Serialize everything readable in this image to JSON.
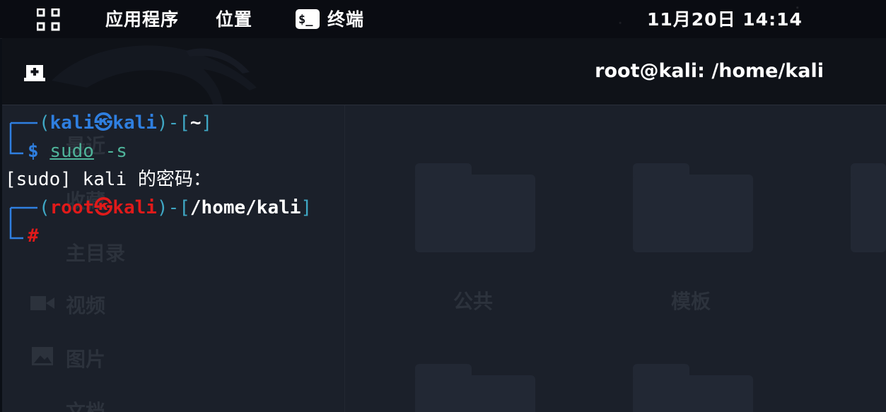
{
  "topbar": {
    "apps_label": "应用程序",
    "places_label": "位置",
    "terminal_label": "终端",
    "terminal_badge": "$_",
    "datetime": "11月20日  14:14"
  },
  "window": {
    "title": "root@kali: /home/kali"
  },
  "terminal": {
    "line1": {
      "open": "(",
      "user": "kali",
      "sep_icon": "㉿",
      "host": "kali",
      "close": ")-[",
      "path": "~",
      "end": "]"
    },
    "line2": {
      "prompt": "$",
      "cmd": "sudo",
      "args": " -s"
    },
    "line3": {
      "text": "[sudo] kali 的密码："
    },
    "line4": {
      "open": "(",
      "user": "root",
      "sep_icon": "㉿",
      "host": "kali",
      "close": ")-[",
      "path": "/home/kali",
      "end": "]"
    },
    "line5": {
      "prompt": "#"
    }
  },
  "background_files": {
    "sidebar": [
      "最近",
      "收藏",
      "主目录",
      "视频",
      "图片",
      "文档"
    ],
    "folders": [
      "公共",
      "模板"
    ]
  },
  "colors": {
    "user_prompt": "#2f7fe0",
    "root_prompt": "#e01a1a",
    "path_bracket": "#4fb49a",
    "command": "#4fb49a"
  }
}
